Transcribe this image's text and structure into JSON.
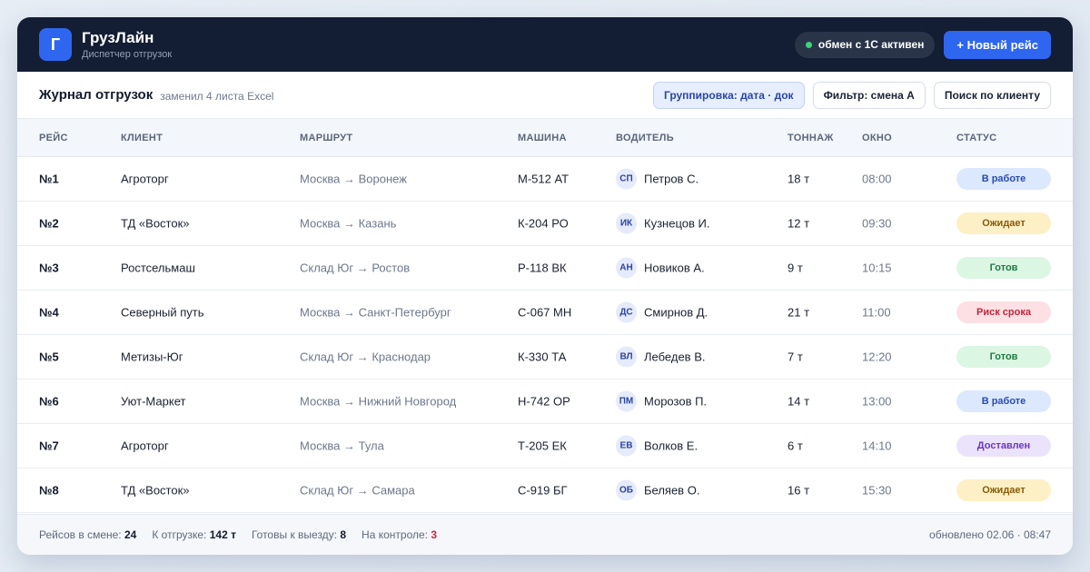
{
  "header": {
    "logo_letter": "Г",
    "title": "ГрузЛайн",
    "subtitle": "Диспетчер отгрузок",
    "sync_label": "обмен с 1С активен",
    "new_trip_label": "+ Новый рейс"
  },
  "toolbar": {
    "title": "Журнал отгрузок",
    "subtitle": "заменил 4 листа Excel",
    "grouping_label": "Группировка: дата · док",
    "filter_label": "Фильтр: смена А",
    "search_label": "Поиск по клиенту"
  },
  "table": {
    "columns": {
      "trip": "РЕЙС",
      "client": "КЛИЕНТ",
      "route": "МАРШРУТ",
      "car": "МАШИНА",
      "driver": "ВОДИТЕЛЬ",
      "tonnage": "ТОННАЖ",
      "window": "ОКНО",
      "status": "СТАТУС"
    },
    "rows": [
      {
        "trip": "№1",
        "client": "Агроторг",
        "route": "Москва → Воронеж",
        "car": "М-512 АТ",
        "initials": "СП",
        "driver": "Петров С.",
        "tonnage": "18 т",
        "window": "08:00",
        "status": "В работе"
      },
      {
        "trip": "№2",
        "client": "ТД «Восток»",
        "route": "Москва → Казань",
        "car": "К-204 РО",
        "initials": "ИК",
        "driver": "Кузнецов И.",
        "tonnage": "12 т",
        "window": "09:30",
        "status": "Ожидает"
      },
      {
        "trip": "№3",
        "client": "Ростсельмаш",
        "route": "Склад Юг → Ростов",
        "car": "Р-118 ВК",
        "initials": "АН",
        "driver": "Новиков А.",
        "tonnage": "9 т",
        "window": "10:15",
        "status": "Готов"
      },
      {
        "trip": "№4",
        "client": "Северный путь",
        "route": "Москва → Санкт-Петербург",
        "car": "С-067 МН",
        "initials": "ДС",
        "driver": "Смирнов Д.",
        "tonnage": "21 т",
        "window": "11:00",
        "status": "Риск срока"
      },
      {
        "trip": "№5",
        "client": "Метизы-Юг",
        "route": "Склад Юг → Краснодар",
        "car": "К-330 ТА",
        "initials": "ВЛ",
        "driver": "Лебедев В.",
        "tonnage": "7 т",
        "window": "12:20",
        "status": "Готов"
      },
      {
        "trip": "№6",
        "client": "Уют-Маркет",
        "route": "Москва → Нижний Новгород",
        "car": "Н-742 ОР",
        "initials": "ПМ",
        "driver": "Морозов П.",
        "tonnage": "14 т",
        "window": "13:00",
        "status": "В работе"
      },
      {
        "trip": "№7",
        "client": "Агроторг",
        "route": "Москва → Тула",
        "car": "Т-205 ЕК",
        "initials": "ЕВ",
        "driver": "Волков Е.",
        "tonnage": "6 т",
        "window": "14:10",
        "status": "Доставлен"
      },
      {
        "trip": "№8",
        "client": "ТД «Восток»",
        "route": "Склад Юг → Самара",
        "car": "С-919 БГ",
        "initials": "ОБ",
        "driver": "Беляев О.",
        "tonnage": "16 т",
        "window": "15:30",
        "status": "Ожидает"
      }
    ]
  },
  "footer": {
    "trips_label": "Рейсов в смене:",
    "trips_value": "24",
    "load_label": "К отгрузке:",
    "load_value": "142 т",
    "ready_label": "Готовы к выезду:",
    "ready_value": "8",
    "control_label": "На контроле:",
    "control_value": "3",
    "updated": "обновлено 02.06 · 08:47"
  },
  "colors": {
    "topbar": "#131d33",
    "accent": "#2f66f0",
    "sync_ok": "#3bd37a",
    "alert": "#d3283d"
  }
}
